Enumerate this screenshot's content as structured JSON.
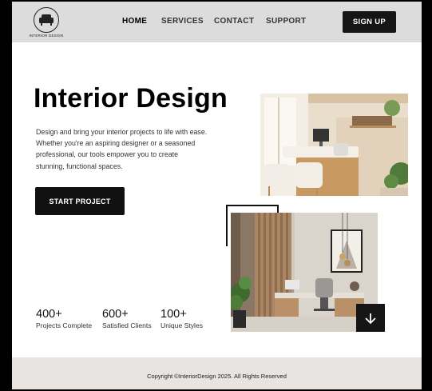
{
  "brand": {
    "logo_text": "INTERIOR DESIGN"
  },
  "nav": [
    {
      "label": "HOME"
    },
    {
      "label": "SERVICES"
    },
    {
      "label": "CONTACT"
    },
    {
      "label": "SUPPORT"
    }
  ],
  "signup_label": "SIGN UP",
  "hero": {
    "title": "Interior Design",
    "description": "Design and bring your interior projects to life with ease. Whether you're an aspiring designer or a seasoned professional, our tools empower you to create stunning, functional spaces.",
    "cta_label": "START PROJECT"
  },
  "stats": [
    {
      "number": "400+",
      "label": "Projects Complete"
    },
    {
      "number": "600+",
      "label": "Satisfied Clients"
    },
    {
      "number": "100+",
      "label": "Unique Styles"
    }
  ],
  "footer": {
    "copyright": "Copyright ©InteriorDesign 2025. All Rights Reserved"
  },
  "icons": {
    "scroll_down": "arrow-down-icon",
    "logo": "armchair-icon"
  },
  "colors": {
    "header_bg": "#dcdcdc",
    "button_bg": "#151515",
    "footer_bg": "#e7e4e2"
  }
}
